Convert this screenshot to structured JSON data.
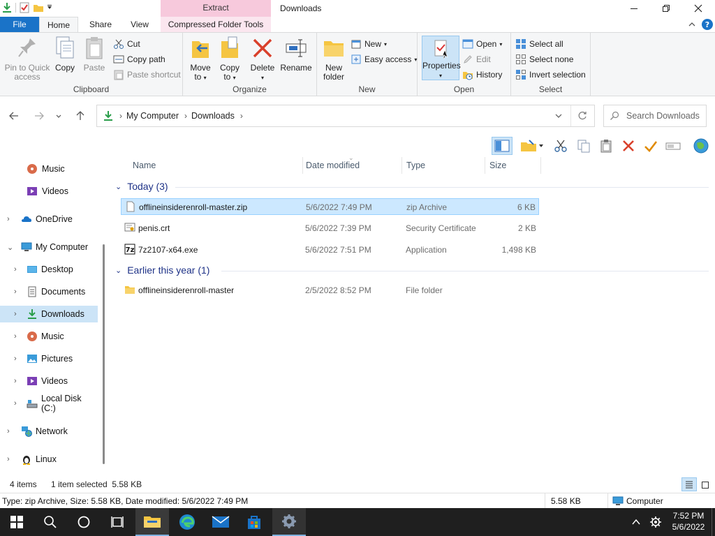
{
  "window": {
    "title": "Downloads",
    "contextual_tab_group": "Extract"
  },
  "ribbon_tabs": [
    "File",
    "Home",
    "Share",
    "View",
    "Compressed Folder Tools"
  ],
  "ribbon": {
    "clipboard": {
      "label": "Clipboard",
      "pin": "Pin to Quick access",
      "pin_line1": "Pin to Quick",
      "pin_line2": "access",
      "copy": "Copy",
      "paste": "Paste",
      "cut": "Cut",
      "copy_path": "Copy path",
      "paste_shortcut": "Paste shortcut"
    },
    "organize": {
      "label": "Organize",
      "move_to_1": "Move",
      "move_to_2": "to",
      "copy_to_1": "Copy",
      "copy_to_2": "to",
      "delete": "Delete",
      "rename": "Rename"
    },
    "new": {
      "label": "New",
      "new_folder_1": "New",
      "new_folder_2": "folder",
      "new_item": "New",
      "easy_access": "Easy access"
    },
    "open": {
      "label": "Open",
      "properties": "Properties",
      "open": "Open",
      "edit": "Edit",
      "history": "History"
    },
    "select": {
      "label": "Select",
      "select_all": "Select all",
      "select_none": "Select none",
      "invert_selection": "Invert selection"
    }
  },
  "address": {
    "crumbs": [
      "My Computer",
      "Downloads"
    ],
    "search_placeholder": "Search Downloads"
  },
  "nav": [
    {
      "label": "Music",
      "icon": "music-icon"
    },
    {
      "label": "Videos",
      "icon": "videos-icon"
    },
    {
      "label": "OneDrive",
      "icon": "onedrive-icon"
    },
    {
      "label": "My Computer",
      "icon": "computer-icon"
    },
    {
      "label": "Desktop",
      "icon": "desktop-icon"
    },
    {
      "label": "Documents",
      "icon": "documents-icon"
    },
    {
      "label": "Downloads",
      "icon": "downloads-icon"
    },
    {
      "label": "Music",
      "icon": "music-icon"
    },
    {
      "label": "Pictures",
      "icon": "pictures-icon"
    },
    {
      "label": "Videos",
      "icon": "videos-icon"
    },
    {
      "label": "Local Disk (C:)",
      "icon": "disk-icon"
    },
    {
      "label": "Network",
      "icon": "network-icon"
    },
    {
      "label": "Linux",
      "icon": "linux-icon"
    }
  ],
  "columns": {
    "name": "Name",
    "date": "Date modified",
    "type": "Type",
    "size": "Size"
  },
  "groups": [
    {
      "title": "Today (3)",
      "files": [
        {
          "name": "offlineinsiderenroll-master.zip",
          "date": "5/6/2022 7:49 PM",
          "type": "zip Archive",
          "size": "6 KB",
          "icon": "zip-file-icon"
        },
        {
          "name": "penis.crt",
          "date": "5/6/2022 7:39 PM",
          "type": "Security Certificate",
          "size": "2 KB",
          "icon": "certificate-icon"
        },
        {
          "name": "7z2107-x64.exe",
          "date": "5/6/2022 7:51 PM",
          "type": "Application",
          "size": "1,498 KB",
          "icon": "7zip-icon"
        }
      ]
    },
    {
      "title": "Earlier this year (1)",
      "files": [
        {
          "name": "offlineinsiderenroll-master",
          "date": "2/5/2022 8:52 PM",
          "type": "File folder",
          "size": "",
          "icon": "folder-icon"
        }
      ]
    }
  ],
  "status": {
    "items": "4 items",
    "selected": "1 item selected  5.58 KB",
    "details": "Type: zip Archive, Size: 5.58 KB, Date modified: 5/6/2022 7:49 PM",
    "size": "5.58 KB",
    "location": "Computer"
  },
  "clock": {
    "time": "7:52 PM",
    "date": "5/6/2022"
  },
  "colors": {
    "accent": "#1a73c8",
    "selection": "#cce8ff",
    "group_header": "#1e3287"
  }
}
